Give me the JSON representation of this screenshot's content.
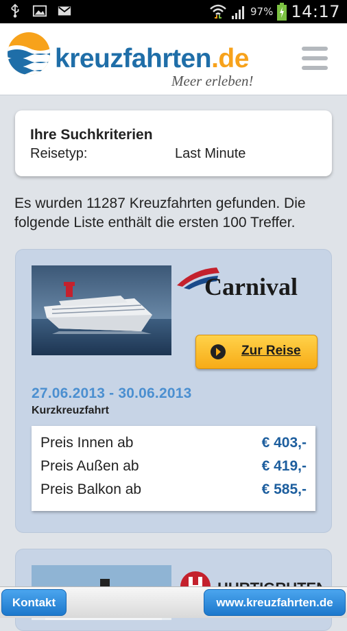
{
  "status_bar": {
    "battery": "97%",
    "time": "14:17",
    "icons": [
      "usb-icon",
      "image-icon",
      "gmail-icon",
      "wifi-icon",
      "signal-icon",
      "battery-charging-icon"
    ]
  },
  "header": {
    "logo_name": "kreuzfahrten",
    "logo_tld": ".de",
    "tagline": "Meer erleben!",
    "menu_icon": "hamburger-menu-icon",
    "colors": {
      "brand_blue": "#1f6ea8",
      "brand_orange": "#f7a21b"
    }
  },
  "search_criteria": {
    "title": "Ihre Suchkriterien",
    "label": "Reisetyp:",
    "value": "Last Minute"
  },
  "results_text": "Es wurden 11287 Kreuzfahrten gefunden. Die folgende Liste enthält die ersten 100 Treffer.",
  "cruises": [
    {
      "brand": "Carnival",
      "button_label": "Zur Reise",
      "dates": "27.06.2013 - 30.06.2013",
      "type": "Kurzkreuzfahrt",
      "prices": [
        {
          "label": "Preis Innen ab",
          "value": "€ 403,-"
        },
        {
          "label": "Preis Außen ab",
          "value": "€ 419,-"
        },
        {
          "label": "Preis Balkon ab",
          "value": "€ 585,-"
        }
      ]
    },
    {
      "brand": "HURTIGRUTEN"
    }
  ],
  "bottom_bar": {
    "contact_label": "Kontakt",
    "website_label": "www.kreuzfahrten.de"
  }
}
